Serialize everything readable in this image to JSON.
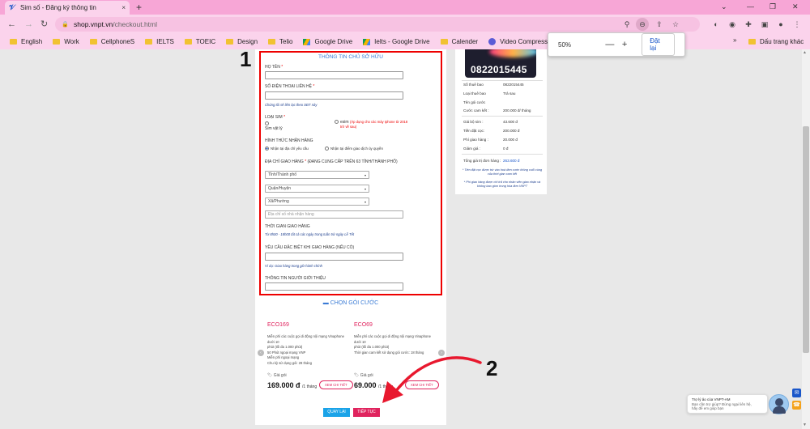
{
  "browser": {
    "tab_title": "Sim số - Đăng ký thông tin",
    "tab_close": "×",
    "new_tab": "+",
    "url_host": "shop.vnpt.vn",
    "url_path": "/checkout.html",
    "bookmarks": [
      {
        "label": "English",
        "icon": "folder"
      },
      {
        "label": "Work",
        "icon": "folder"
      },
      {
        "label": "CellphoneS",
        "icon": "folder"
      },
      {
        "label": "IELTS",
        "icon": "folder"
      },
      {
        "label": "TOEIC",
        "icon": "folder"
      },
      {
        "label": "Design",
        "icon": "folder"
      },
      {
        "label": "Telio",
        "icon": "folder"
      },
      {
        "label": "Google Drive",
        "icon": "google-drive"
      },
      {
        "label": "Ielts - Google Drive",
        "icon": "google-drive"
      },
      {
        "label": "Calender",
        "icon": "folder"
      },
      {
        "label": "Video Compressor |...",
        "icon": "video-compressor"
      }
    ],
    "bookmark_overflow": "»",
    "other_bookmarks": "Dấu trang khác",
    "zoom_popup": {
      "percent": "50%",
      "minus": "—",
      "plus": "+",
      "reset": "Đặt lại"
    }
  },
  "form": {
    "title": "THÔNG TIN CHỦ SỞ HỮU",
    "name_label": "HỌ TÊN",
    "phone_label": "SỐ ĐIỆN THOẠI LIÊN HỆ",
    "phone_note": "Chúng tôi sẽ liên lạc theo SĐT này",
    "sim_type_label": "LOẠI SIM",
    "sim_physical": "Sim vật lý",
    "esim": "esim",
    "esim_note_1": "(Áp dụng cho các máy Iphone từ 2018",
    "esim_note_2": "trở về sau)",
    "delivery_label": "HÌNH THỨC NHẬN HÀNG",
    "delivery_home": "Nhận tại địa chỉ yêu cầu",
    "delivery_store": "Nhận tại điểm giao dịch ủy quyền",
    "address_label": "ĐỊA CHỈ GIAO HÀNG",
    "address_hint": "(ĐANG CUNG CẤP TRÊN 63 TỈNH/THÀNH PHỐ)",
    "province": "Tỉnh/Thành phố",
    "district": "Quận/Huyện",
    "ward": "Xã/Phường",
    "street_placeholder": "Địa chỉ số nhà nhận hàng",
    "time_label": "THỜI GIAN GIAO HÀNG",
    "time_note": "Từ 8h00 - 18h00 tất cả các ngày trong tuần trừ ngày Lễ Tết",
    "special_label": "YÊU CẦU ĐẶC BIỆT KHI GIAO HÀNG (NẾU CÓ)",
    "special_note": "Ví dụ: Giao hàng trong giờ hành chính",
    "referrer_label": "THÔNG TIN NGƯỜI GIỚI THIỆU",
    "required_mark": "*"
  },
  "packages": {
    "title": "CHỌN GÓI CƯỚC",
    "items": [
      {
        "name": "ECO169",
        "features": [
          "Miễn phí các cuộc gọi di động nội mạng Vinaphone dưới 10",
          "phút (tối đa 1.000 phút)",
          "50 Phút ngoại mạng VNP",
          "Miễn phí ngoại mạng",
          "Chu kỳ sử dụng gói: 28 tháng"
        ],
        "price_label": "Giá gói",
        "price": "169.000 đ",
        "unit": "/1 tháng",
        "detail": "XEM CHI TIẾT"
      },
      {
        "name": "ECO69",
        "features": [
          "Miễn phí các cuộc gọi di động nội mạng Vinaphone dưới 10",
          "phút (tối đa 1.000 phút)",
          "Thời gian cam kết sử dụng gói cước: 18 tháng"
        ],
        "price_label": "Giá gói",
        "price": "69.000",
        "unit": "/1 tháng",
        "detail": "XEM CHI TIẾT"
      }
    ],
    "prev": "‹",
    "next": "›"
  },
  "buttons": {
    "back": "QUAY LẠI",
    "next": "TIẾP TỤC"
  },
  "summary": {
    "sim_number_display": "0822015445",
    "rows": [
      {
        "k": "Số thuê bao",
        "v": "0822015445"
      },
      {
        "k": "Loại thuê bao",
        "v": "Trả sau"
      },
      {
        "k": "Tên gói cước",
        "v": ""
      },
      {
        "k": "Cước cam kết :",
        "v": "200.000 đ/ tháng"
      }
    ],
    "costs": [
      {
        "k": "Giá bộ sim :",
        "v": "43.600 đ"
      },
      {
        "k": "Tiền đặt cọc:",
        "v": "200.000 đ"
      },
      {
        "k": "Phí giao hàng :",
        "v": "20.000 đ"
      },
      {
        "k": "Giảm giá :",
        "v": "0 đ"
      }
    ],
    "total_label": "Tổng giá trị đơn hàng :",
    "total_value": "263.600 đ",
    "note_1": "* Tiền đặt cọc được trừ vào hoá đơn cước thông cuối cùng của thời gian cam kết",
    "note_2": "* Phí giao hàng được chi trả cho nhân viên giao nhận và không bao gồm trong hóa đơn VNPT"
  },
  "annotations": {
    "step1": "1",
    "step2": "2"
  },
  "chat": {
    "title": "Trợ lý ảo của VNPT-AM",
    "line1": "Bạn cần trợ giúp? Đừng ngại liên hệ,",
    "line2": "hãy để em giúp bạn"
  },
  "colors": {
    "accent_pink": "#e0245e",
    "accent_blue": "#3a7bd5",
    "highlight_red": "#e00",
    "chrome_pink": "#fbd3ec"
  }
}
